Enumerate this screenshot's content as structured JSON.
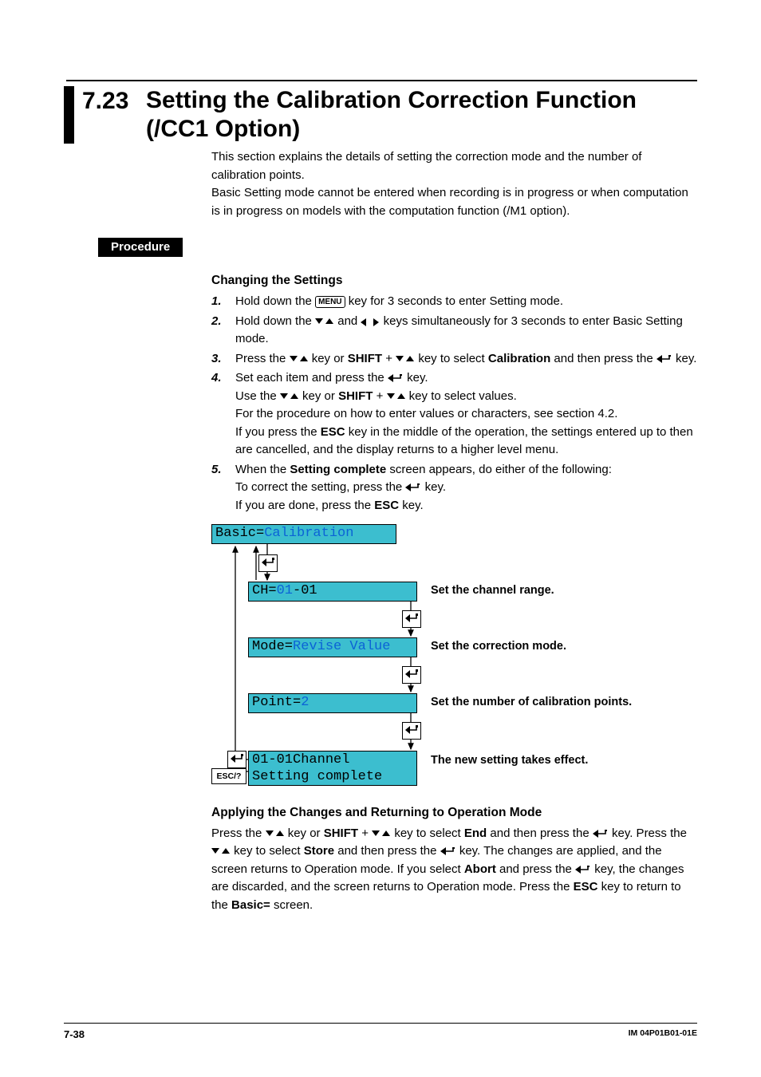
{
  "section_number": "7.23",
  "section_title_line1": "Setting the Calibration Correction Function",
  "section_title_line2": "(/CC1 Option)",
  "intro_p1": "This section explains the details of setting the correction mode and the number of calibration points.",
  "intro_p2": "Basic Setting mode cannot be entered when recording is in progress or when computation is in progress on models with the computation function (/M1 option).",
  "procedure_label": "Procedure",
  "changing_heading": "Changing the Settings",
  "steps": {
    "s1": {
      "num": "1.",
      "pre": "Hold down the ",
      "menu": "MENU",
      "post": " key for 3 seconds to enter Setting mode."
    },
    "s2": {
      "num": "2.",
      "pre": "Hold down the ",
      "mid": " and ",
      "post": " keys simultaneously for 3 seconds to enter Basic Setting mode."
    },
    "s3": {
      "num": "3.",
      "pre": "Press the ",
      "mid1": " key or ",
      "shift": "SHIFT",
      "plus": " + ",
      "mid2": " key to select ",
      "cal": "Calibration",
      "post1": " and then press the ",
      "post2": " key."
    },
    "s4": {
      "num": "4.",
      "l1a": "Set each item and press the ",
      "l1b": " key.",
      "l2a": "Use the ",
      "l2b": " key or ",
      "l2shift": "SHIFT",
      "l2plus": " + ",
      "l2c": " key to select values.",
      "l3": "For the procedure on how to enter values or characters, see section 4.2.",
      "l4a": "If you press the ",
      "l4esc": "ESC",
      "l4b": " key in the middle of the operation, the settings entered up to then are cancelled, and the display returns to a higher level menu."
    },
    "s5": {
      "num": "5.",
      "l1a": "When the ",
      "l1b": "Setting complete",
      "l1c": " screen appears, do either of the following:",
      "l2a": "To correct the setting, press the ",
      "l2b": " key.",
      "l3a": "If you are done, press the ",
      "l3esc": "ESC",
      "l3b": " key."
    }
  },
  "diagram": {
    "lcd_top_pre": "Basic=",
    "lcd_top_val": "Calibration",
    "lcd_ch_pre": "CH=",
    "lcd_ch_val": "01",
    "lcd_ch_post": "-01",
    "lcd_mode_pre": "Mode=",
    "lcd_mode_val": "Revise Value",
    "lcd_point_pre": "Point=",
    "lcd_point_val": "2",
    "lcd_done_l1": "01-01Channel",
    "lcd_done_l2": "Setting complete",
    "cap_ch": "Set the channel range.",
    "cap_mode": "Set the correction mode.",
    "cap_point": "Set the number of calibration points.",
    "cap_done": "The new setting takes effect.",
    "esc_label": "ESC/?"
  },
  "applying": {
    "heading": "Applying the Changes and Returning to Operation Mode",
    "t1": "Press the ",
    "t2": " key or ",
    "shift": "SHIFT",
    "plus": " + ",
    "t3": " key to select ",
    "end": "End",
    "t4": " and then press the ",
    "t5": " key. Press the ",
    "t6": " key to select ",
    "store": "Store",
    "t7": " and then press the ",
    "t8": " key. The changes are applied, and the screen returns to Operation mode. If you select ",
    "abort": "Abort",
    "t9": " and press the ",
    "t10": " key, the changes are discarded, and the screen returns to Operation mode. Press the ",
    "esc": "ESC",
    "t11": " key to return to the ",
    "basic": "Basic=",
    "t12": " screen."
  },
  "footer": {
    "page": "7-38",
    "doc": "IM 04P01B01-01E"
  }
}
